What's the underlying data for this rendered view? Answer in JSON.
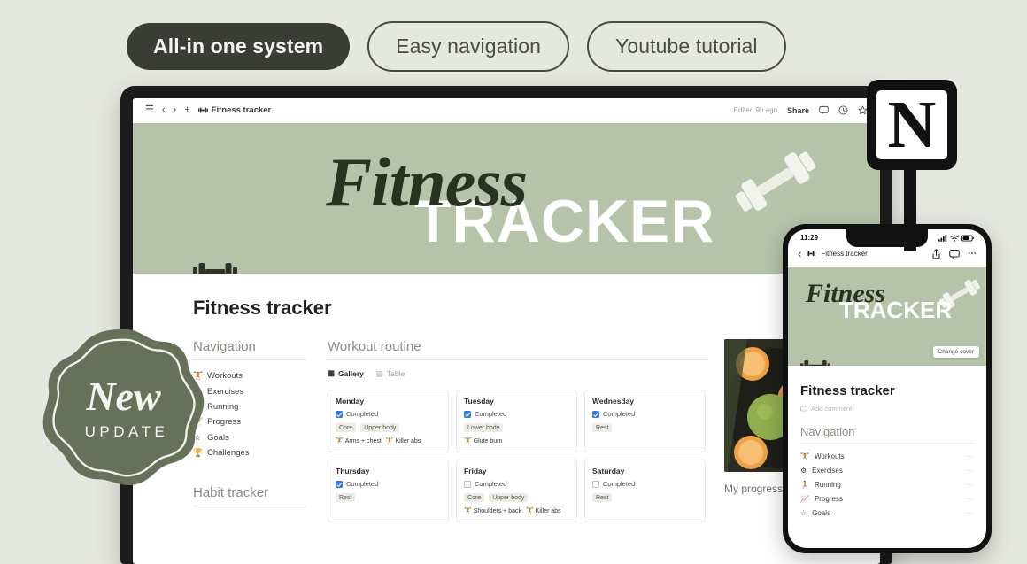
{
  "theme": {
    "background": "#e5e8e0",
    "pill_dark_bg": "#3a3d35",
    "cover_green": "#b6c3a9",
    "badge_green": "#67715a",
    "accent_blue": "#2f7de1"
  },
  "pills": [
    {
      "label": "All-in one system",
      "style": "dark"
    },
    {
      "label": "Easy navigation",
      "style": "light"
    },
    {
      "label": "Youtube tutorial",
      "style": "light"
    }
  ],
  "badge": {
    "word": "New",
    "sub": "UPDATE"
  },
  "brand": {
    "logo_letter": "N",
    "name": "notion-logo"
  },
  "laptop": {
    "topbar": {
      "menu_icon": "☰",
      "back_icon": "‹",
      "forward_icon": "›",
      "plus_icon": "+",
      "page_icon": "🏋",
      "breadcrumb": "Fitness tracker",
      "edited": "Edited 9h ago",
      "share": "Share",
      "comment_icon": "💬",
      "clock_icon": "🕒",
      "star_icon": "☆"
    },
    "cover": {
      "script_word": "Fitness",
      "block_word": "TRACKER"
    },
    "page_title": "Fitness tracker",
    "navigation": {
      "heading": "Navigation",
      "items": [
        {
          "icon": "🏋",
          "label": "Workouts"
        },
        {
          "icon": "⚙",
          "label": "Exercises"
        },
        {
          "icon": "🏃",
          "label": "Running"
        },
        {
          "icon": "📈",
          "label": "Progress"
        },
        {
          "icon": "☆",
          "label": "Goals"
        },
        {
          "icon": "🏆",
          "label": "Challenges"
        }
      ]
    },
    "habit_tracker": {
      "heading": "Habit tracker"
    },
    "workout": {
      "heading": "Workout routine",
      "views": [
        {
          "label": "Gallery",
          "icon": "▦",
          "active": true
        },
        {
          "label": "Table",
          "icon": "▤",
          "active": false
        }
      ],
      "checkbox_label": "Completed",
      "cards": [
        {
          "day": "Monday",
          "completed": true,
          "tags": [
            "Core",
            "Upper body"
          ],
          "links": [
            "Arms + chest",
            "Killer abs"
          ]
        },
        {
          "day": "Tuesday",
          "completed": true,
          "tags": [
            "Lower body"
          ],
          "links": [
            "Glute burn"
          ]
        },
        {
          "day": "Wednesday",
          "completed": true,
          "tags": [
            "Rest"
          ],
          "links": []
        },
        {
          "day": "Thursday",
          "completed": true,
          "tags": [
            "Rest"
          ],
          "links": []
        },
        {
          "day": "Friday",
          "completed": false,
          "tags": [
            "Core",
            "Upper body"
          ],
          "links": [
            "Shoulders + back",
            "Killer abs"
          ]
        },
        {
          "day": "Saturday",
          "completed": false,
          "tags": [
            "Rest"
          ],
          "links": []
        }
      ]
    },
    "right_column": {
      "caption": "My progress"
    }
  },
  "phone": {
    "status": {
      "time": "11:29",
      "signal_icon": "▮▮▮",
      "wifi_icon": "▾",
      "battery_icon": "▬"
    },
    "nav": {
      "back_icon": "‹",
      "page_icon": "🏋",
      "title": "Fitness tracker",
      "share_icon": "⇧",
      "comment_icon": "💬",
      "more_icon": "⋯"
    },
    "cover": {
      "script_word": "Fitness",
      "block_word": "TRACKER",
      "change_cover": "Change cover"
    },
    "page_title": "Fitness tracker",
    "add_comment": "Add comment",
    "navigation": {
      "heading": "Navigation",
      "items": [
        {
          "icon": "🏋",
          "label": "Workouts",
          "more": "⋯"
        },
        {
          "icon": "⚙",
          "label": "Exercises",
          "more": "⋯"
        },
        {
          "icon": "🏃",
          "label": "Running",
          "more": "⋯"
        },
        {
          "icon": "📈",
          "label": "Progress",
          "more": "⋯"
        },
        {
          "icon": "☆",
          "label": "Goals",
          "more": "⋯"
        }
      ]
    }
  }
}
